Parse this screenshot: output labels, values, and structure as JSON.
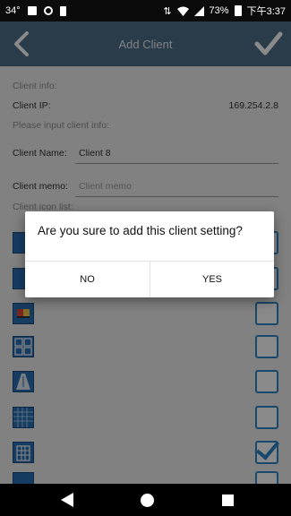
{
  "status_bar": {
    "temperature": "34°",
    "time": "下午3:37",
    "battery": "73%",
    "icons": [
      "image-notification-icon",
      "settings-notification-icon",
      "battery-saver-icon",
      "data-arrows-icon",
      "wifi-icon",
      "signal-icon",
      "battery-icon"
    ]
  },
  "header": {
    "title": "Add Client",
    "back_icon": "chevron-left-icon",
    "confirm_icon": "checkmark-icon"
  },
  "form": {
    "client_info_label": "Client info:",
    "client_ip_label": "Client IP:",
    "client_ip_value": "169.254.2.8",
    "input_hint": "Please input client info:",
    "client_name_label": "Client Name:",
    "client_name_value": "Client 8",
    "client_memo_label": "Client memo:",
    "client_memo_placeholder": "Client memo",
    "icon_list_label": "Client icon list:"
  },
  "icon_list": [
    {
      "icon": "client-icon-1",
      "checked": false
    },
    {
      "icon": "client-icon-2",
      "checked": false
    },
    {
      "icon": "client-icon-3",
      "checked": false
    },
    {
      "icon": "client-icon-abcd",
      "checked": false
    },
    {
      "icon": "client-icon-road",
      "checked": false
    },
    {
      "icon": "client-icon-grid",
      "checked": false
    },
    {
      "icon": "client-icon-building",
      "checked": true
    },
    {
      "icon": "client-icon-8",
      "checked": false
    }
  ],
  "dialog": {
    "message": "Are you sure to add this client setting?",
    "no_label": "NO",
    "yes_label": "YES"
  },
  "nav_bar": {
    "back_icon": "back-triangle-icon",
    "home_icon": "home-circle-icon",
    "recent_icon": "recent-square-icon"
  },
  "colors": {
    "header_bg": "#4e6e89",
    "accent": "#2d86c8",
    "icon_blue": "#2b6fb4"
  }
}
